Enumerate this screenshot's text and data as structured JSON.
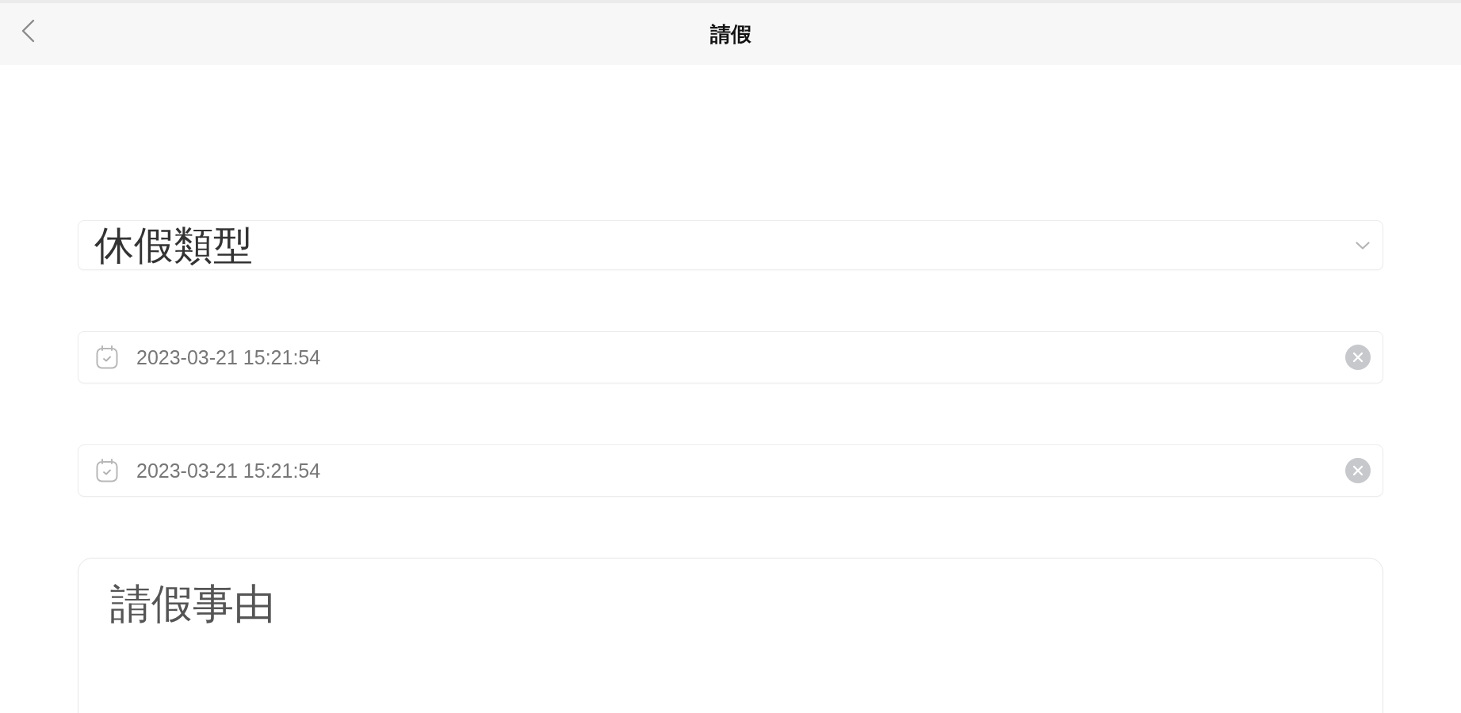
{
  "header": {
    "title": "請假"
  },
  "form": {
    "leave_type": {
      "placeholder": "休假類型"
    },
    "date_fields": [
      {
        "value": "2023-03-21 15:21:54"
      },
      {
        "value": "2023-03-21 15:21:54"
      }
    ],
    "reason": {
      "placeholder": "請假事由"
    }
  }
}
